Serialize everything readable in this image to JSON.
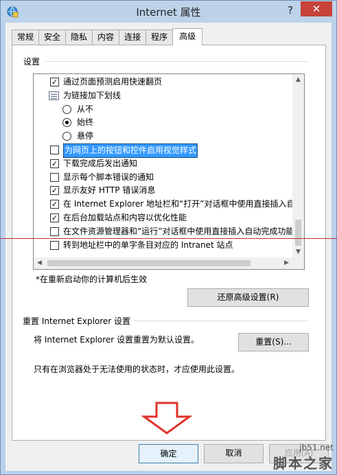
{
  "window": {
    "title": "Internet 属性",
    "help": "?",
    "close": "✕"
  },
  "tabs": [
    "常规",
    "安全",
    "隐私",
    "内容",
    "连接",
    "程序",
    "高级"
  ],
  "active_tab": "高级",
  "settings": {
    "label": "设置",
    "rows": [
      {
        "kind": "checkbox",
        "checked": true,
        "label": "通过页面预测启用快速翻页"
      },
      {
        "kind": "group",
        "label": "为链接加下划线"
      },
      {
        "kind": "radio",
        "checked": false,
        "label": "从不"
      },
      {
        "kind": "radio",
        "checked": true,
        "label": "始终"
      },
      {
        "kind": "radio",
        "checked": false,
        "label": "悬停"
      },
      {
        "kind": "checkbox",
        "checked": false,
        "selected": true,
        "label": "为网页上的按钮和控件启用视觉样式"
      },
      {
        "kind": "checkbox",
        "checked": true,
        "label": "下载完成后发出通知"
      },
      {
        "kind": "checkbox",
        "checked": false,
        "label": "显示每个脚本错误的通知"
      },
      {
        "kind": "checkbox",
        "checked": true,
        "label": "显示友好 HTTP 错误消息"
      },
      {
        "kind": "checkbox",
        "checked": true,
        "label": "在 Internet Explorer 地址栏和“打开”对话框中使用直接插入自"
      },
      {
        "kind": "checkbox",
        "checked": true,
        "label": "在后台加载站点和内容以优化性能"
      },
      {
        "kind": "checkbox",
        "checked": false,
        "label": "在文件资源管理器和“运行”对话框中使用直接插入自动完成功能"
      },
      {
        "kind": "checkbox",
        "checked": false,
        "label": "转到地址栏中的单字条目对应的 Intranet 站点"
      }
    ]
  },
  "note": "*在重新启动你的计算机后生效",
  "restore_button": "还原高级设置(R)",
  "reset_section": {
    "title": "重置 Internet Explorer 设置",
    "description": "将 Internet Explorer 设置重置为默认设置。",
    "button": "重置(S)...",
    "warning": "只有在浏览器处于无法使用的状态时，才应使用此设置。"
  },
  "footer": {
    "ok": "确定",
    "cancel": "取消",
    "apply": "应用(A)"
  },
  "watermark": {
    "url": "jb51.net",
    "name": "脚本之家"
  },
  "colors": {
    "selection": "#3399ff",
    "close": "#c7433a",
    "annotation": "#e0312c"
  },
  "icons": {
    "app": "internet-options-icon",
    "arrow": "down-arrow-annotation"
  }
}
